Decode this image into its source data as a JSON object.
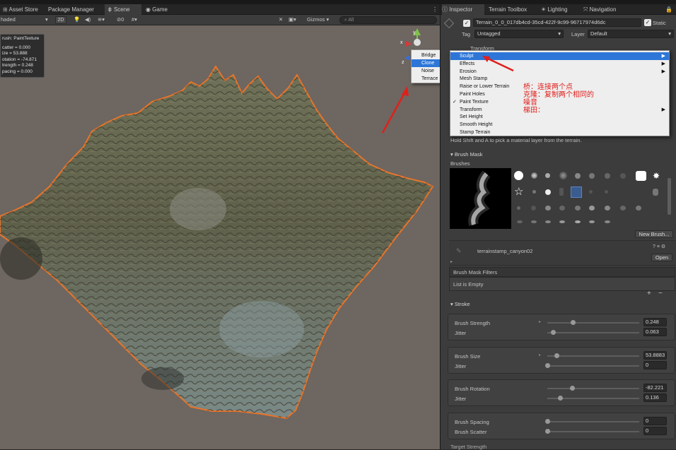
{
  "left_tabs": [
    {
      "label": "Asset Store"
    },
    {
      "label": "Package Manager"
    },
    {
      "label": "Scene"
    },
    {
      "label": "Game"
    }
  ],
  "scene_toolbar": {
    "shading": "haded",
    "mode_2d": "2D",
    "gizmos": "Gizmos",
    "search_placeholder": "All"
  },
  "brush_info": {
    "title": "rush: PaintTexture",
    "lines": [
      "catter = 0.000",
      "ize = 53.888",
      "otation = -74.871",
      "trength = 0.248",
      "pacing = 0.000"
    ]
  },
  "popup_left": [
    "Bridge",
    "Clone",
    "Noise",
    "Terrace"
  ],
  "right_tabs": [
    {
      "label": "Inspector"
    },
    {
      "label": "Terrain Toolbox"
    },
    {
      "label": "Lighting"
    },
    {
      "label": "Navigation"
    }
  ],
  "inspector": {
    "object_name": "Terrain_0_0_017db4cd-35cd-422f-9c99-96717974d6dc",
    "static_label": "Static",
    "tag_label": "Tag",
    "tag_value": "Untagged",
    "layer_label": "Layer",
    "layer_value": "Default",
    "transform_label": "Transform"
  },
  "tool_menu": [
    {
      "label": "Sculpt",
      "submenu": true,
      "checked": false,
      "selected": true
    },
    {
      "label": "Effects",
      "submenu": true,
      "checked": false,
      "selected": false
    },
    {
      "label": "Erosion",
      "submenu": true,
      "checked": false,
      "selected": false
    },
    {
      "label": "Mesh Stamp",
      "submenu": false,
      "checked": false,
      "selected": false
    },
    {
      "label": "Raise or Lower Terrain",
      "submenu": false,
      "checked": false,
      "selected": false
    },
    {
      "label": "Paint Holes",
      "submenu": false,
      "checked": false,
      "selected": false
    },
    {
      "label": "Paint Texture",
      "submenu": false,
      "checked": true,
      "selected": false
    },
    {
      "label": "Transform",
      "submenu": true,
      "checked": false,
      "selected": false
    },
    {
      "label": "Set Height",
      "submenu": false,
      "checked": false,
      "selected": false
    },
    {
      "label": "Smooth Height",
      "submenu": false,
      "checked": false,
      "selected": false
    },
    {
      "label": "Stamp Terrain",
      "submenu": false,
      "checked": false,
      "selected": false
    }
  ],
  "annotations": [
    "桥：连接两个点",
    "克隆：复制两个相同的",
    "噪音",
    "梯田："
  ],
  "hint_text": "Hold Shift and A to pick a material layer from the terrain.",
  "brush_mask": {
    "header": "Brush Mask",
    "brushes_label": "Brushes",
    "new_brush_button": "New Brush...",
    "stamp_name": "terrainstamp_canyon02",
    "open_button": "Open",
    "filters_label": "Brush Mask Filters",
    "list_empty": "List is Empty",
    "add": "+",
    "remove": "−"
  },
  "stroke": {
    "header": "Stroke",
    "rows": [
      {
        "label": "Brush Strength",
        "value": "0.248",
        "fraction": 0.28
      },
      {
        "label": "Jitter",
        "value": "0.063",
        "fraction": 0.06
      },
      {
        "label": "Brush Size",
        "value": "53.8883",
        "fraction": 0.1
      },
      {
        "label": "Jitter",
        "value": "0",
        "fraction": 0.0
      },
      {
        "label": "Brush Rotation",
        "value": "-82.221",
        "fraction": 0.27
      },
      {
        "label": "Jitter",
        "value": "0.136",
        "fraction": 0.14
      },
      {
        "label": "Brush Spacing",
        "value": "0",
        "fraction": 0.0
      },
      {
        "label": "Brush Scatter",
        "value": "0",
        "fraction": 0.0
      }
    ],
    "target_strength": "Target Strength"
  },
  "colors": {
    "accent": "#2d76d8",
    "annotation": "#e0201c",
    "terrain_outline": "#e8742a"
  }
}
